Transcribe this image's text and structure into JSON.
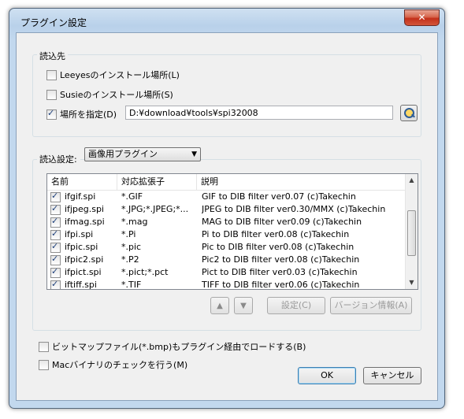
{
  "window": {
    "title": "プラグイン設定",
    "close_glyph": "✕"
  },
  "read_source": {
    "group_label": "読込先",
    "options": [
      {
        "label": "Leeyesのインストール場所(L)",
        "checked": false
      },
      {
        "label": "Susieのインストール場所(S)",
        "checked": false
      },
      {
        "label": "場所を指定(D)",
        "checked": true
      }
    ],
    "path_value": "D:¥download¥tools¥spi32008",
    "browse_icon": "browse-folder-icon"
  },
  "read_settings": {
    "group_label": "読込設定:",
    "selected": "画像用プラグイン",
    "columns": [
      "名前",
      "対応拡張子",
      "説明"
    ],
    "rows": [
      {
        "name": "ifgif.spi",
        "ext": "*.GIF",
        "desc": "GIF to DIB filter ver0.07 (c)Takechin",
        "checked": true
      },
      {
        "name": "ifjpeg.spi",
        "ext": "*.JPG;*.JPEG;*...",
        "desc": "JPEG to DIB filter ver0.30/MMX (c)Takechin",
        "checked": true
      },
      {
        "name": "ifmag.spi",
        "ext": "*.mag",
        "desc": "MAG to DIB filter ver0.09 (c)Takechin",
        "checked": true
      },
      {
        "name": "ifpi.spi",
        "ext": "*.Pi",
        "desc": "Pi to DIB filter ver0.08 (c)Takechin",
        "checked": true
      },
      {
        "name": "ifpic.spi",
        "ext": "*.pic",
        "desc": "Pic to DIB filter ver0.08 (c)Takechin",
        "checked": true
      },
      {
        "name": "ifpic2.spi",
        "ext": "*.P2",
        "desc": "Pic2 to DIB filter ver0.08 (c)Takechin",
        "checked": true
      },
      {
        "name": "ifpict.spi",
        "ext": "*.pict;*.pct",
        "desc": "Pict to DIB filter ver0.03 (c)Takechin",
        "checked": true
      },
      {
        "name": "iftiff.spi",
        "ext": "*.TIF",
        "desc": "TIFF to DIB filter ver0.06 (c)Takechin",
        "checked": true
      }
    ],
    "move_up_glyph": "▲",
    "move_down_glyph": "▼",
    "settings_label": "設定(C)",
    "version_label": "バージョン情報(A)"
  },
  "bottom": {
    "options": [
      {
        "label": "ビットマップファイル(*.bmp)もプラグイン経由でロードする(B)",
        "checked": false
      },
      {
        "label": "Macバイナリのチェックを行う(M)",
        "checked": false
      }
    ],
    "ok_label": "OK",
    "cancel_label": "キャンセル"
  }
}
